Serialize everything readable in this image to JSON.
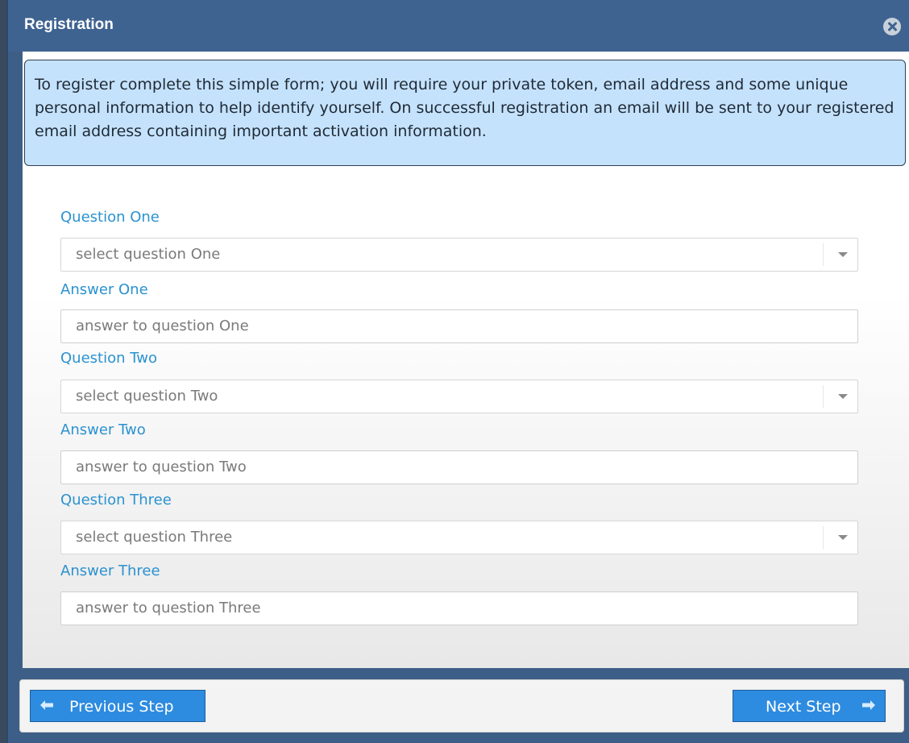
{
  "dialog": {
    "title": "Registration"
  },
  "info": {
    "text": "To register complete this simple form; you will require your private token, email address and some unique personal information to help identify yourself. On successful registration an email will be sent to your registered email address containing important activation information."
  },
  "form": {
    "question_one_label": "Question One",
    "question_one_placeholder": "select question One",
    "answer_one_label": "Answer One",
    "answer_one_placeholder": "answer to question One",
    "question_two_label": "Question Two",
    "question_two_placeholder": "select question Two",
    "answer_two_label": "Answer Two",
    "answer_two_placeholder": "answer to question Two",
    "question_three_label": "Question Three",
    "question_three_placeholder": "select question Three",
    "answer_three_label": "Answer Three",
    "answer_three_placeholder": "answer to question Three"
  },
  "footer": {
    "previous_label": "Previous Step",
    "next_label": "Next Step"
  },
  "colors": {
    "titlebar": "#3f6390",
    "label": "#2a92d0",
    "info_bg": "#c5e2fc",
    "button": "#2d8be0"
  },
  "icons": {
    "close": "close-circle-icon",
    "previous": "arrow-left-icon",
    "next": "arrow-right-icon",
    "dropdown": "chevron-down-icon"
  }
}
